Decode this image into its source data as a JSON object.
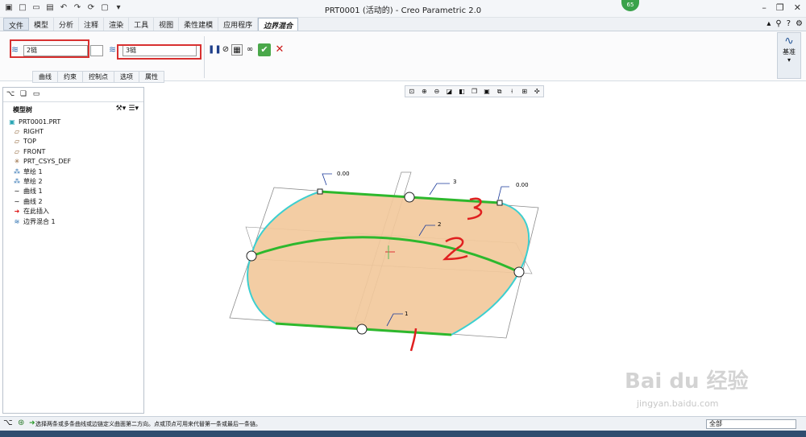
{
  "window": {
    "title": "PRT0001 (活动的) - Creo Parametric 2.0",
    "badge": "65"
  },
  "ribbon_tabs": [
    "文件",
    "模型",
    "分析",
    "注释",
    "渲染",
    "工具",
    "视图",
    "柔性建模",
    "应用程序",
    "边界混合"
  ],
  "feature": {
    "first_direction_value": "2链",
    "second_direction_value": "3链",
    "subtabs": [
      "曲线",
      "约束",
      "控制点",
      "选项",
      "属性"
    ],
    "datum_label": "基准"
  },
  "tree": {
    "header": "模型树",
    "items": [
      {
        "label": "PRT0001.PRT",
        "icon": "part-icon"
      },
      {
        "label": "RIGHT",
        "icon": "plane-icon"
      },
      {
        "label": "TOP",
        "icon": "plane-icon"
      },
      {
        "label": "FRONT",
        "icon": "plane-icon"
      },
      {
        "label": "PRT_CSYS_DEF",
        "icon": "csys-icon"
      },
      {
        "label": "草绘 1",
        "icon": "sketch-icon"
      },
      {
        "label": "草绘 2",
        "icon": "sketch-icon"
      },
      {
        "label": "曲线 1",
        "icon": "curve-icon"
      },
      {
        "label": "曲线 2",
        "icon": "curve-icon"
      },
      {
        "label": "在此插入",
        "icon": "insert-arrow-icon"
      },
      {
        "label": "边界混合 1",
        "icon": "boundary-blend-icon"
      }
    ]
  },
  "graphics": {
    "dim_left": "0.00",
    "dim_right": "0.00",
    "label_1": "1",
    "label_2": "2",
    "label_3": "3",
    "surface_color": "#f2c89a",
    "edge_color": "#3ccfd0",
    "curve_color": "#2db82d"
  },
  "status": {
    "message": "选择两条或多条曲线或边链定义曲面第二方向。点或顶点可用来代替第一条或最后一条链。",
    "filter_value": "全部"
  },
  "watermark": {
    "brand": "Bai du 经验",
    "url": "jingyan.baidu.com"
  }
}
